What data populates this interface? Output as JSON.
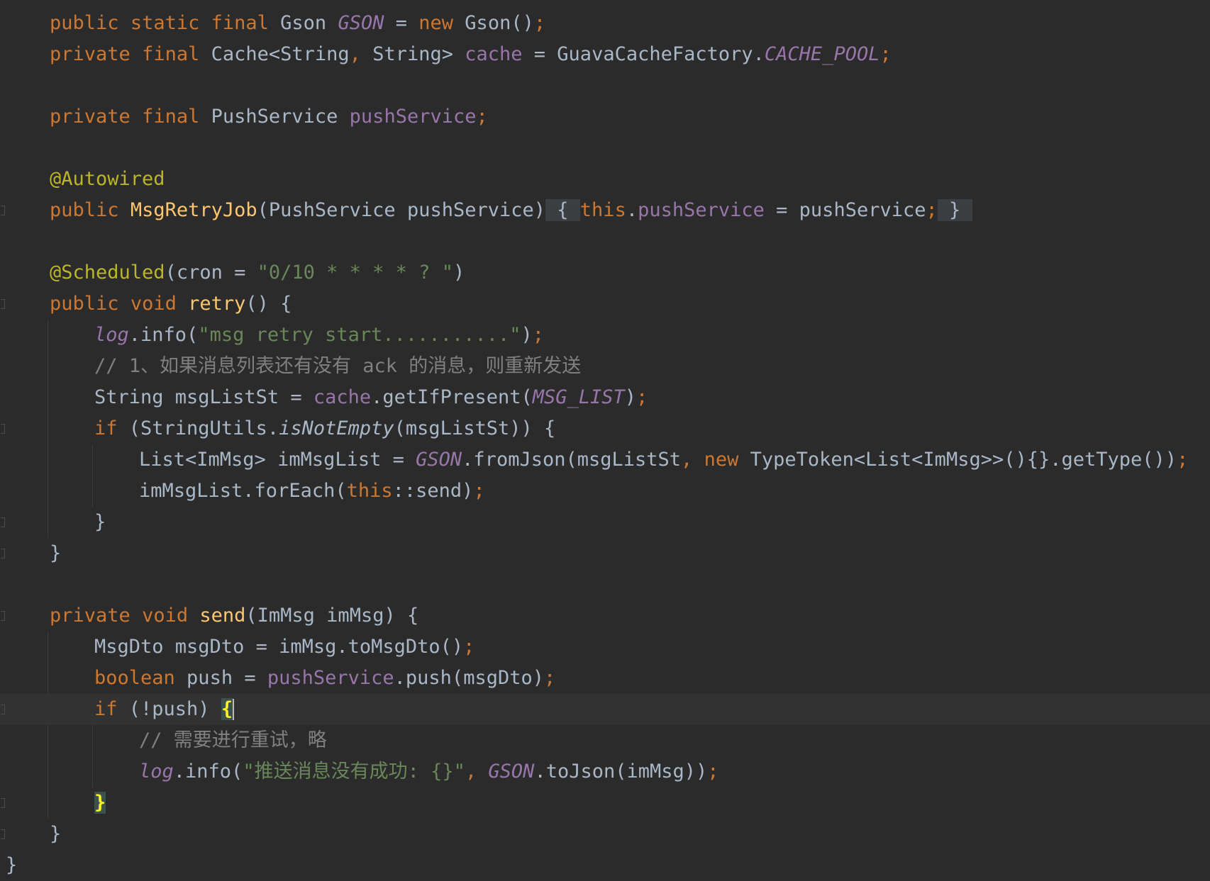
{
  "editor": {
    "lines": [
      {
        "tokens": [
          {
            "t": "public",
            "c": "kw"
          },
          {
            "t": " ",
            "c": "plain"
          },
          {
            "t": "static",
            "c": "kw"
          },
          {
            "t": " ",
            "c": "plain"
          },
          {
            "t": "final",
            "c": "kw"
          },
          {
            "t": " Gson ",
            "c": "plain"
          },
          {
            "t": "GSON",
            "c": "static"
          },
          {
            "t": " = ",
            "c": "plain"
          },
          {
            "t": "new",
            "c": "kw"
          },
          {
            "t": " Gson()",
            "c": "plain"
          },
          {
            "t": ";",
            "c": "punct"
          }
        ]
      },
      {
        "tokens": [
          {
            "t": "private",
            "c": "kw"
          },
          {
            "t": " ",
            "c": "plain"
          },
          {
            "t": "final",
            "c": "kw"
          },
          {
            "t": " Cache<String",
            "c": "plain"
          },
          {
            "t": ",",
            "c": "punct"
          },
          {
            "t": " String> ",
            "c": "plain"
          },
          {
            "t": "cache",
            "c": "field"
          },
          {
            "t": " = GuavaCacheFactory.",
            "c": "plain"
          },
          {
            "t": "CACHE_POOL",
            "c": "static"
          },
          {
            "t": ";",
            "c": "punct"
          }
        ]
      },
      {
        "tokens": []
      },
      {
        "tokens": [
          {
            "t": "private",
            "c": "kw"
          },
          {
            "t": " ",
            "c": "plain"
          },
          {
            "t": "final",
            "c": "kw"
          },
          {
            "t": " PushService ",
            "c": "plain"
          },
          {
            "t": "pushService",
            "c": "field"
          },
          {
            "t": ";",
            "c": "punct"
          }
        ]
      },
      {
        "tokens": []
      },
      {
        "tokens": [
          {
            "t": "@Autowired",
            "c": "ann"
          }
        ]
      },
      {
        "tokens": [
          {
            "t": "public",
            "c": "kw"
          },
          {
            "t": " ",
            "c": "plain"
          },
          {
            "t": "MsgRetryJob",
            "c": "fn"
          },
          {
            "t": "(PushService pushService)",
            "c": "plain"
          },
          {
            "t": " { ",
            "c": "fold"
          },
          {
            "t": "this",
            "c": "kw"
          },
          {
            "t": ".",
            "c": "plain"
          },
          {
            "t": "pushService",
            "c": "field"
          },
          {
            "t": " = pushService",
            "c": "plain"
          },
          {
            "t": ";",
            "c": "punct"
          },
          {
            "t": " } ",
            "c": "fold"
          }
        ]
      },
      {
        "tokens": []
      },
      {
        "tokens": [
          {
            "t": "@Scheduled",
            "c": "ann"
          },
          {
            "t": "(cron = ",
            "c": "plain"
          },
          {
            "t": "\"0/10 * * * * ? \"",
            "c": "str"
          },
          {
            "t": ")",
            "c": "plain"
          }
        ]
      },
      {
        "tokens": [
          {
            "t": "public",
            "c": "kw"
          },
          {
            "t": " ",
            "c": "plain"
          },
          {
            "t": "void",
            "c": "kw"
          },
          {
            "t": " ",
            "c": "plain"
          },
          {
            "t": "retry",
            "c": "fn"
          },
          {
            "t": "() {",
            "c": "plain"
          }
        ]
      },
      {
        "tokens": [
          {
            "t": "log",
            "c": "static"
          },
          {
            "t": ".info(",
            "c": "plain"
          },
          {
            "t": "\"msg retry start...........\"",
            "c": "str"
          },
          {
            "t": ")",
            "c": "plain"
          },
          {
            "t": ";",
            "c": "punct"
          }
        ]
      },
      {
        "tokens": [
          {
            "t": "// 1、如果消息列表还有没有 ack 的消息，则重新发送",
            "c": "comment"
          }
        ]
      },
      {
        "tokens": [
          {
            "t": "String msgListSt = ",
            "c": "plain"
          },
          {
            "t": "cache",
            "c": "field"
          },
          {
            "t": ".getIfPresent(",
            "c": "plain"
          },
          {
            "t": "MSG_LIST",
            "c": "static"
          },
          {
            "t": ")",
            "c": "plain"
          },
          {
            "t": ";",
            "c": "punct"
          }
        ]
      },
      {
        "tokens": [
          {
            "t": "if",
            "c": "kw"
          },
          {
            "t": " (StringUtils.",
            "c": "plain"
          },
          {
            "t": "isNotEmpty",
            "c": "italic"
          },
          {
            "t": "(msgListSt)) {",
            "c": "plain"
          }
        ]
      },
      {
        "tokens": [
          {
            "t": "List<ImMsg> imMsgList = ",
            "c": "plain"
          },
          {
            "t": "GSON",
            "c": "static"
          },
          {
            "t": ".fromJson(msgListSt",
            "c": "plain"
          },
          {
            "t": ",",
            "c": "punct"
          },
          {
            "t": " ",
            "c": "plain"
          },
          {
            "t": "new",
            "c": "kw"
          },
          {
            "t": " TypeToken<List<ImMsg>>(){}.getType())",
            "c": "plain"
          },
          {
            "t": ";",
            "c": "punct"
          }
        ]
      },
      {
        "tokens": [
          {
            "t": "imMsgList.forEach(",
            "c": "plain"
          },
          {
            "t": "this",
            "c": "kw"
          },
          {
            "t": "::send)",
            "c": "plain"
          },
          {
            "t": ";",
            "c": "punct"
          }
        ]
      },
      {
        "tokens": [
          {
            "t": "}",
            "c": "plain"
          }
        ]
      },
      {
        "tokens": [
          {
            "t": "}",
            "c": "plain"
          }
        ]
      },
      {
        "tokens": []
      },
      {
        "tokens": [
          {
            "t": "private",
            "c": "kw"
          },
          {
            "t": " ",
            "c": "plain"
          },
          {
            "t": "void",
            "c": "kw"
          },
          {
            "t": " ",
            "c": "plain"
          },
          {
            "t": "send",
            "c": "fn"
          },
          {
            "t": "(ImMsg imMsg) {",
            "c": "plain"
          }
        ]
      },
      {
        "tokens": [
          {
            "t": "MsgDto msgDto = imMsg.toMsgDto()",
            "c": "plain"
          },
          {
            "t": ";",
            "c": "punct"
          }
        ]
      },
      {
        "tokens": [
          {
            "t": "boolean",
            "c": "kw"
          },
          {
            "t": " push = ",
            "c": "plain"
          },
          {
            "t": "pushService",
            "c": "field"
          },
          {
            "t": ".push(msgDto)",
            "c": "plain"
          },
          {
            "t": ";",
            "c": "punct"
          }
        ]
      },
      {
        "tokens": [
          {
            "t": "if",
            "c": "kw"
          },
          {
            "t": " (!push) ",
            "c": "plain"
          },
          {
            "t": "{",
            "c": "match"
          }
        ]
      },
      {
        "tokens": [
          {
            "t": "// 需要进行重试，略",
            "c": "comment"
          }
        ]
      },
      {
        "tokens": [
          {
            "t": "log",
            "c": "static"
          },
          {
            "t": ".info(",
            "c": "plain"
          },
          {
            "t": "\"推送消息没有成功: {}\"",
            "c": "str"
          },
          {
            "t": ",",
            "c": "punct"
          },
          {
            "t": " ",
            "c": "plain"
          },
          {
            "t": "GSON",
            "c": "static"
          },
          {
            "t": ".toJson(imMsg))",
            "c": "plain"
          },
          {
            "t": ";",
            "c": "punct"
          }
        ]
      },
      {
        "tokens": [
          {
            "t": "}",
            "c": "match"
          }
        ]
      },
      {
        "tokens": [
          {
            "t": "}",
            "c": "plain"
          }
        ]
      },
      {
        "tokens": [
          {
            "t": "}",
            "c": "plain"
          }
        ]
      }
    ]
  }
}
